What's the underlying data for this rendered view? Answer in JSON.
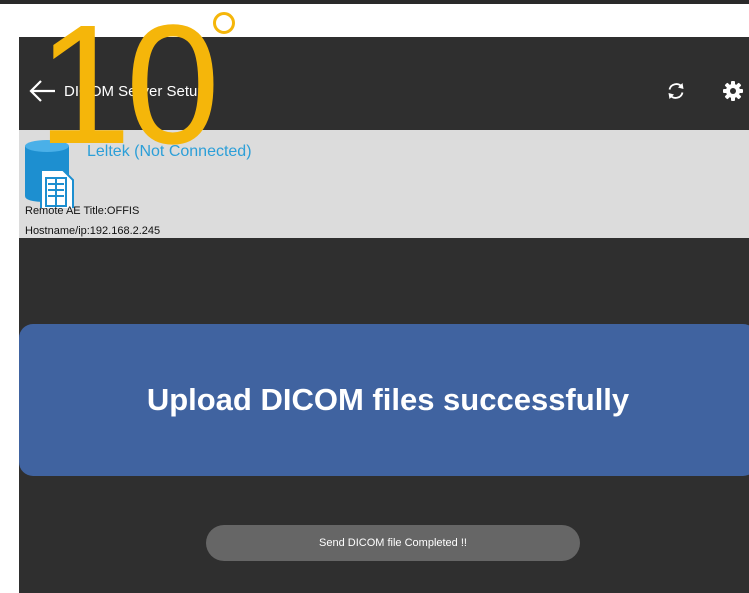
{
  "overlay": {
    "number": "10"
  },
  "app_bar": {
    "title": "DICOM Server Setup",
    "icons": {
      "back": "arrow-left-icon",
      "refresh": "refresh-icon",
      "settings": "gear-icon"
    }
  },
  "server": {
    "name": "Leltek (Not Connected)",
    "ae_title": "Remote AE Title:OFFIS",
    "hostname": "Hostname/ip:192.168.2.245",
    "icon": "database-document-icon"
  },
  "banner": {
    "text": "Upload DICOM files successfully"
  },
  "toast": {
    "text": "Send DICOM file Completed !!"
  },
  "colors": {
    "screen_background": "#2f2f2f",
    "server_item_background": "#dcdcdc",
    "server_name": "#2c9fd8",
    "banner": "#4063a0",
    "toast": "#666666",
    "overlay": "#f5b60a"
  }
}
